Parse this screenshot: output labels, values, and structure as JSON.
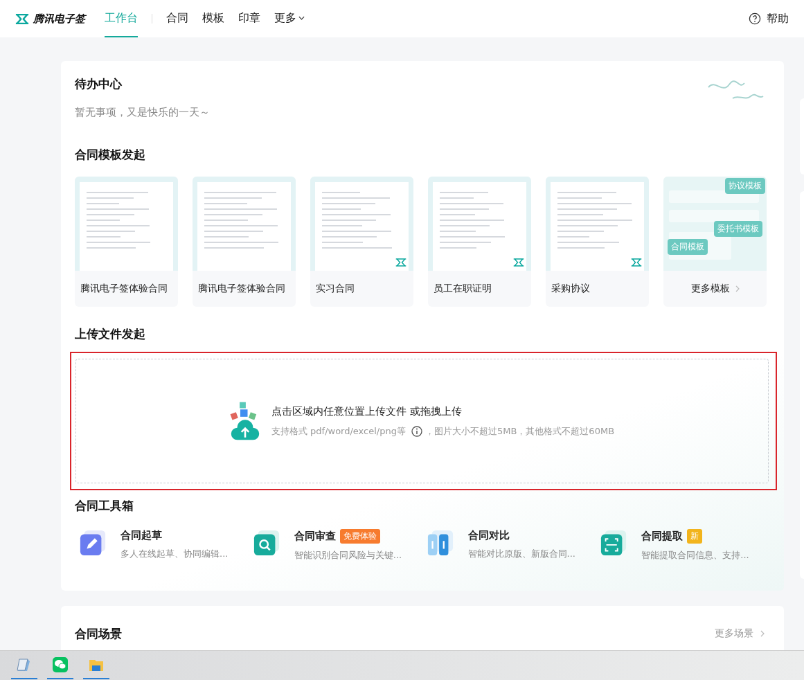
{
  "nav": {
    "logo": "腾讯电子签",
    "tabs": [
      {
        "label": "工作台",
        "selected": true
      },
      {
        "label": "合同",
        "selected": false
      },
      {
        "label": "模板",
        "selected": false
      },
      {
        "label": "印章",
        "selected": false
      },
      {
        "label": "更多",
        "selected": false
      }
    ],
    "help": "帮助"
  },
  "todo": {
    "title": "待办中心",
    "empty_text": "暂无事项，又是快乐的一天～"
  },
  "templates": {
    "title": "合同模板发起",
    "items": [
      {
        "kind": "document",
        "name": "腾讯电子签体验合同"
      },
      {
        "kind": "document",
        "name": "腾讯电子签体验合同"
      },
      {
        "kind": "document",
        "name": "实习合同"
      },
      {
        "kind": "document",
        "name": "员工在职证明"
      },
      {
        "kind": "document",
        "name": "采购协议"
      },
      {
        "kind": "more",
        "name": "更多模板",
        "tags": [
          "协议模板",
          "委托书模板",
          "合同模板"
        ]
      }
    ]
  },
  "upload": {
    "title": "上传文件发起",
    "main_text": "点击区域内任意位置上传文件 或拖拽上传",
    "hint_formats": "支持格式 pdf/word/excel/png等",
    "hint_sizes": "，图片大小不超过5MB，其他格式不超过60MB"
  },
  "tools": {
    "title": "合同工具箱",
    "items": [
      {
        "kind": "draft",
        "name": "合同起草",
        "desc": "多人在线起草、协同编辑..."
      },
      {
        "kind": "review",
        "name": "合同审查",
        "desc": "智能识别合同风险与关键...",
        "badge": "免费体验",
        "color": "#f77b2e"
      },
      {
        "kind": "compare",
        "name": "合同对比",
        "desc": "智能对比原版、新版合同..."
      },
      {
        "kind": "extract",
        "name": "合同提取",
        "desc": "智能提取合同信息、支持...",
        "badge": "新",
        "color": "#f2b41c"
      }
    ]
  },
  "scenes": {
    "title": "合同场景",
    "more": "更多场景"
  },
  "taskbar": {
    "apps": [
      {
        "kind": "notepad"
      },
      {
        "kind": "chat"
      },
      {
        "kind": "folder"
      }
    ]
  }
}
